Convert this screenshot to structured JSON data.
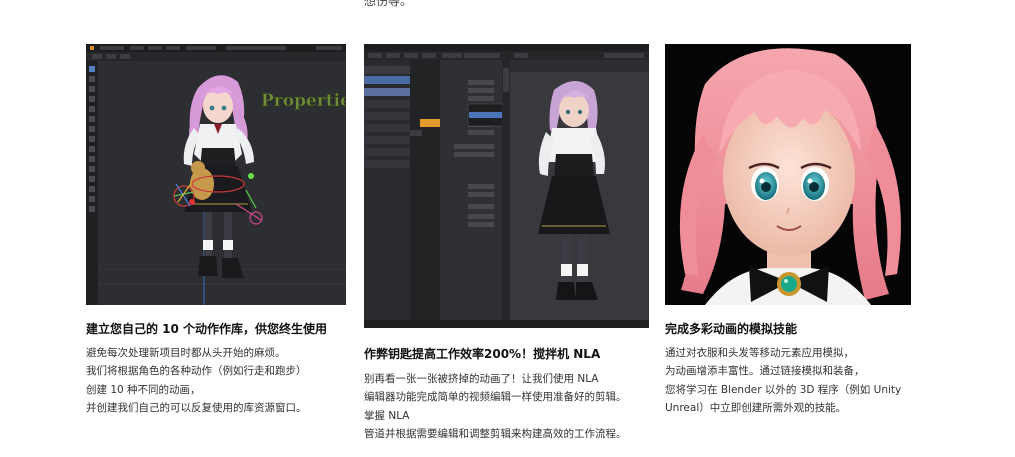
{
  "top_fragment": "想伤等。",
  "cards": [
    {
      "title": "建立您自己的 10 个动作作库，供您终生使用",
      "lines": [
        "避免每次处理新项目时都从头开始的麻烦。",
        "我们将根据角色的各种动作（例如行走和跑步）",
        "创建 10 种不同的动画，",
        "并创建我们自己的可以反复使用的库资源窗口。"
      ],
      "image_overlay_text": "Properties"
    },
    {
      "title": "作弊钥匙提高工作效率200%！搅拌机 NLA",
      "lines": [
        "别再看一张一张被挤掉的动画了！让我们使用 NLA",
        "编辑器功能完成简单的视频编辑一样使用准备好的剪辑。",
        "掌握 NLA",
        "管道并根据需要编辑和调整剪辑来构建高效的工作流程。"
      ]
    },
    {
      "title": "完成多彩动画的模拟技能",
      "lines": [
        "通过对衣服和头发等移动元素应用模拟，",
        "为动画增添丰富性。通过链接模拟和装备，",
        "您将学习在 Blender 以外的 3D 程序（例如 Unity",
        "Unreal）中立即创建所需外观的技能。"
      ]
    }
  ]
}
